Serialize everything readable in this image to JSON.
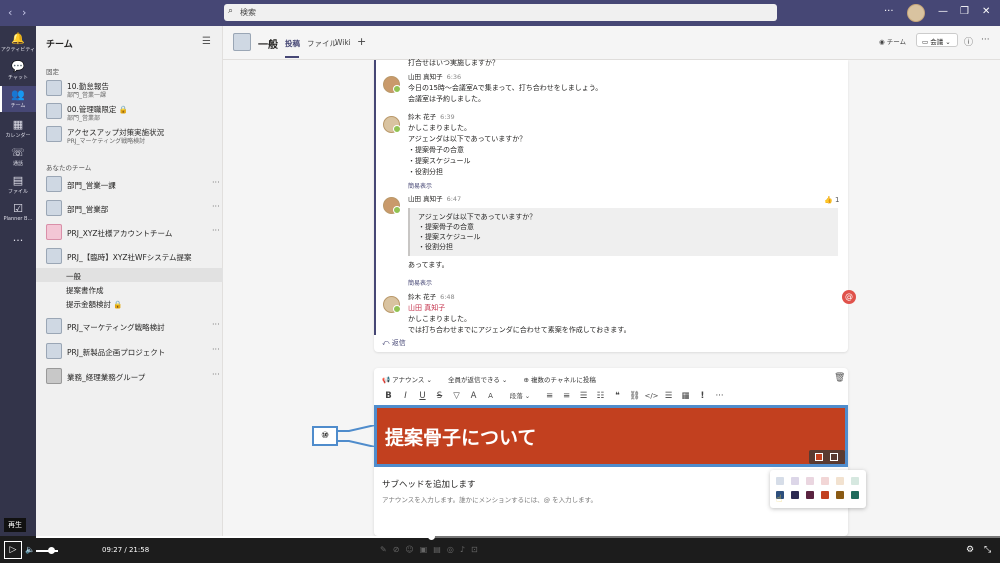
{
  "app": {
    "search_placeholder": "検索",
    "nav_back": "‹",
    "nav_forward": "›",
    "window_more": "···",
    "window_min": "—",
    "window_restore": "❐",
    "window_close": "✕"
  },
  "rail": [
    {
      "label": "アクティビティ",
      "icon": "bell-icon",
      "glyph": "🔔"
    },
    {
      "label": "チャット",
      "icon": "chat-icon",
      "glyph": "💬"
    },
    {
      "label": "チーム",
      "icon": "teams-icon",
      "glyph": "👥"
    },
    {
      "label": "カレンダー",
      "icon": "calendar-icon",
      "glyph": "▦"
    },
    {
      "label": "通話",
      "icon": "phone-icon",
      "glyph": "☏"
    },
    {
      "label": "ファイル",
      "icon": "file-icon",
      "glyph": "▤"
    },
    {
      "label": "Planner B…",
      "icon": "planner-icon",
      "glyph": "☑"
    },
    {
      "label": "",
      "icon": "more-icon",
      "glyph": "···"
    }
  ],
  "sidepanel": {
    "title": "チーム",
    "pinned_label": "固定",
    "your_teams_label": "あなたのチーム",
    "pinned": [
      {
        "name": "10.勤怠報告",
        "sub": "部門_営業一課"
      },
      {
        "name": "00.管理職限定 🔒",
        "sub": "部門_営業部"
      },
      {
        "name": "アクセスアップ対策実施状況",
        "sub": "PRJ_マーケティング戦略検討"
      }
    ],
    "teams": [
      {
        "name": "部門_営業一課"
      },
      {
        "name": "部門_営業部"
      },
      {
        "name": "PRJ_XYZ社様アカウントチーム"
      },
      {
        "name": "PRJ_【臨時】XYZ社WFシステム提案"
      }
    ],
    "channels": [
      "一般",
      "提案書作成",
      "提示金額検討 🔒"
    ],
    "teams2": [
      {
        "name": "PRJ_マーケティング戦略検討"
      },
      {
        "name": "PRJ_新製品企画プロジェクト"
      },
      {
        "name": "業務_経理業務グループ"
      }
    ],
    "more": "···"
  },
  "header": {
    "title": "一般",
    "tabs": [
      "投稿",
      "ファイル",
      "Wiki"
    ],
    "add_tab": "+",
    "team_btn": "チーム",
    "meet_btn": "会議",
    "info": "ⓘ",
    "more": "···"
  },
  "thread": {
    "top_line": "打合せはいつ実施しますか？",
    "msg1": {
      "who": "山田 真知子",
      "time": "6:36",
      "lines": [
        "今日の15時～会議室Aで集まって、打ち合わせをしましょう。",
        "会議室は予約しました。"
      ]
    },
    "msg2": {
      "who": "鈴木 花子",
      "time": "6:39",
      "lines": [
        "かしこまりました。",
        "アジェンダは以下であっていますか？",
        "・提案骨子の合意",
        "・提案スケジュール",
        "・役割分担"
      ]
    },
    "collapse1": "簡易表示",
    "msg3": {
      "who": "山田 真知子",
      "time": "6:47",
      "quote": [
        "アジェンダは以下であっていますか？",
        "・提案骨子の合意",
        "・提案スケジュール",
        "・役割分担"
      ],
      "after": "あってます。"
    },
    "like": "👍 1",
    "collapse2": "簡易表示",
    "msg4": {
      "who": "鈴木 花子",
      "time": "6:48",
      "mention": "山田 真知子",
      "lines": [
        "かしこまりました。",
        "では打ち合わせまでにアジェンダに合わせて素案を作成しておきます。"
      ]
    },
    "reply": "⤺ 返信"
  },
  "compose": {
    "announce": "📢 アナウンス ⌄",
    "who_can_reply": "全員が返信できる ⌄",
    "multi_channel": "⊕ 複数のチャネルに投稿",
    "toolbar": [
      "B",
      "I",
      "U",
      "S",
      "▽",
      "A",
      "A",
      "段落 ⌄",
      "",
      "≡",
      "≡",
      "☰",
      "☷",
      "❝",
      "⛓",
      "</>",
      "☰",
      "▦",
      "!",
      "···"
    ],
    "banner_title": "提案骨子について",
    "subhead": "サブヘッドを追加します",
    "body_hint": "アナウンスを入力します。誰かにメンションするには、@ を入力します。",
    "trash": "🗑"
  },
  "callout": "⑩",
  "mention_badge": "@",
  "palette": {
    "row1": [
      "#d6dde8",
      "#dcd6e8",
      "#ead6e0",
      "#f2d6d6",
      "#f2e2d0",
      "#d6e8e0"
    ],
    "row2": [
      "#2d4f7c",
      "#2d2a52",
      "#5a2340",
      "#c2401f",
      "#8a5a14",
      "#1f6b5c"
    ]
  },
  "player": {
    "tip": "再生",
    "play": "▷",
    "volume": "🔈",
    "time": "09:27 / 21:58",
    "progress": 0.41,
    "settings": "⚙",
    "fullscreen": "⤡"
  }
}
